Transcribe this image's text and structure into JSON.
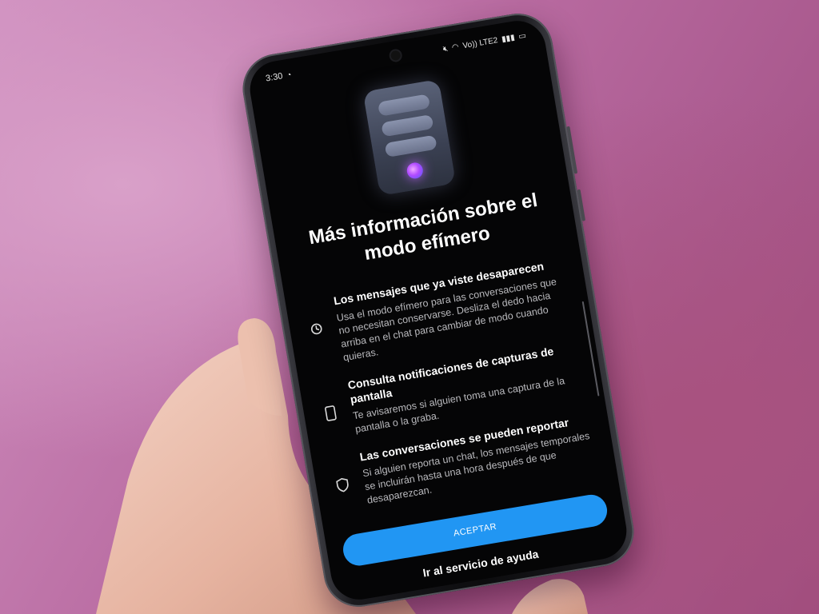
{
  "status_bar": {
    "time": "3:30",
    "network": "Vo)) LTE2"
  },
  "illustration": {
    "accent": "#b14bff",
    "icon": "ephemeral-mode-illustration"
  },
  "dialog": {
    "title": "Más información sobre el modo efímero",
    "features": [
      {
        "icon": "timer-icon",
        "title": "Los mensajes que ya viste desaparecen",
        "description": "Usa el modo efímero para las conversaciones que no necesitan conservarse. Desliza el dedo hacia arriba en el chat para cambiar de modo cuando quieras."
      },
      {
        "icon": "phone-outline-icon",
        "title": "Consulta notificaciones de capturas de pantalla",
        "description": "Te avisaremos si alguien toma una captura de la pantalla o la graba."
      },
      {
        "icon": "shield-icon",
        "title": "Las conversaciones se pueden reportar",
        "description": "Si alguien reporta un chat, los mensajes temporales se incluirán hasta una hora después de que desaparezcan."
      }
    ],
    "accept_label": "ACEPTAR",
    "help_label": "Ir al servicio de ayuda"
  },
  "colors": {
    "accept_button": "#2196f3",
    "screen_bg": "#050506",
    "wall": "#b86aa0"
  }
}
